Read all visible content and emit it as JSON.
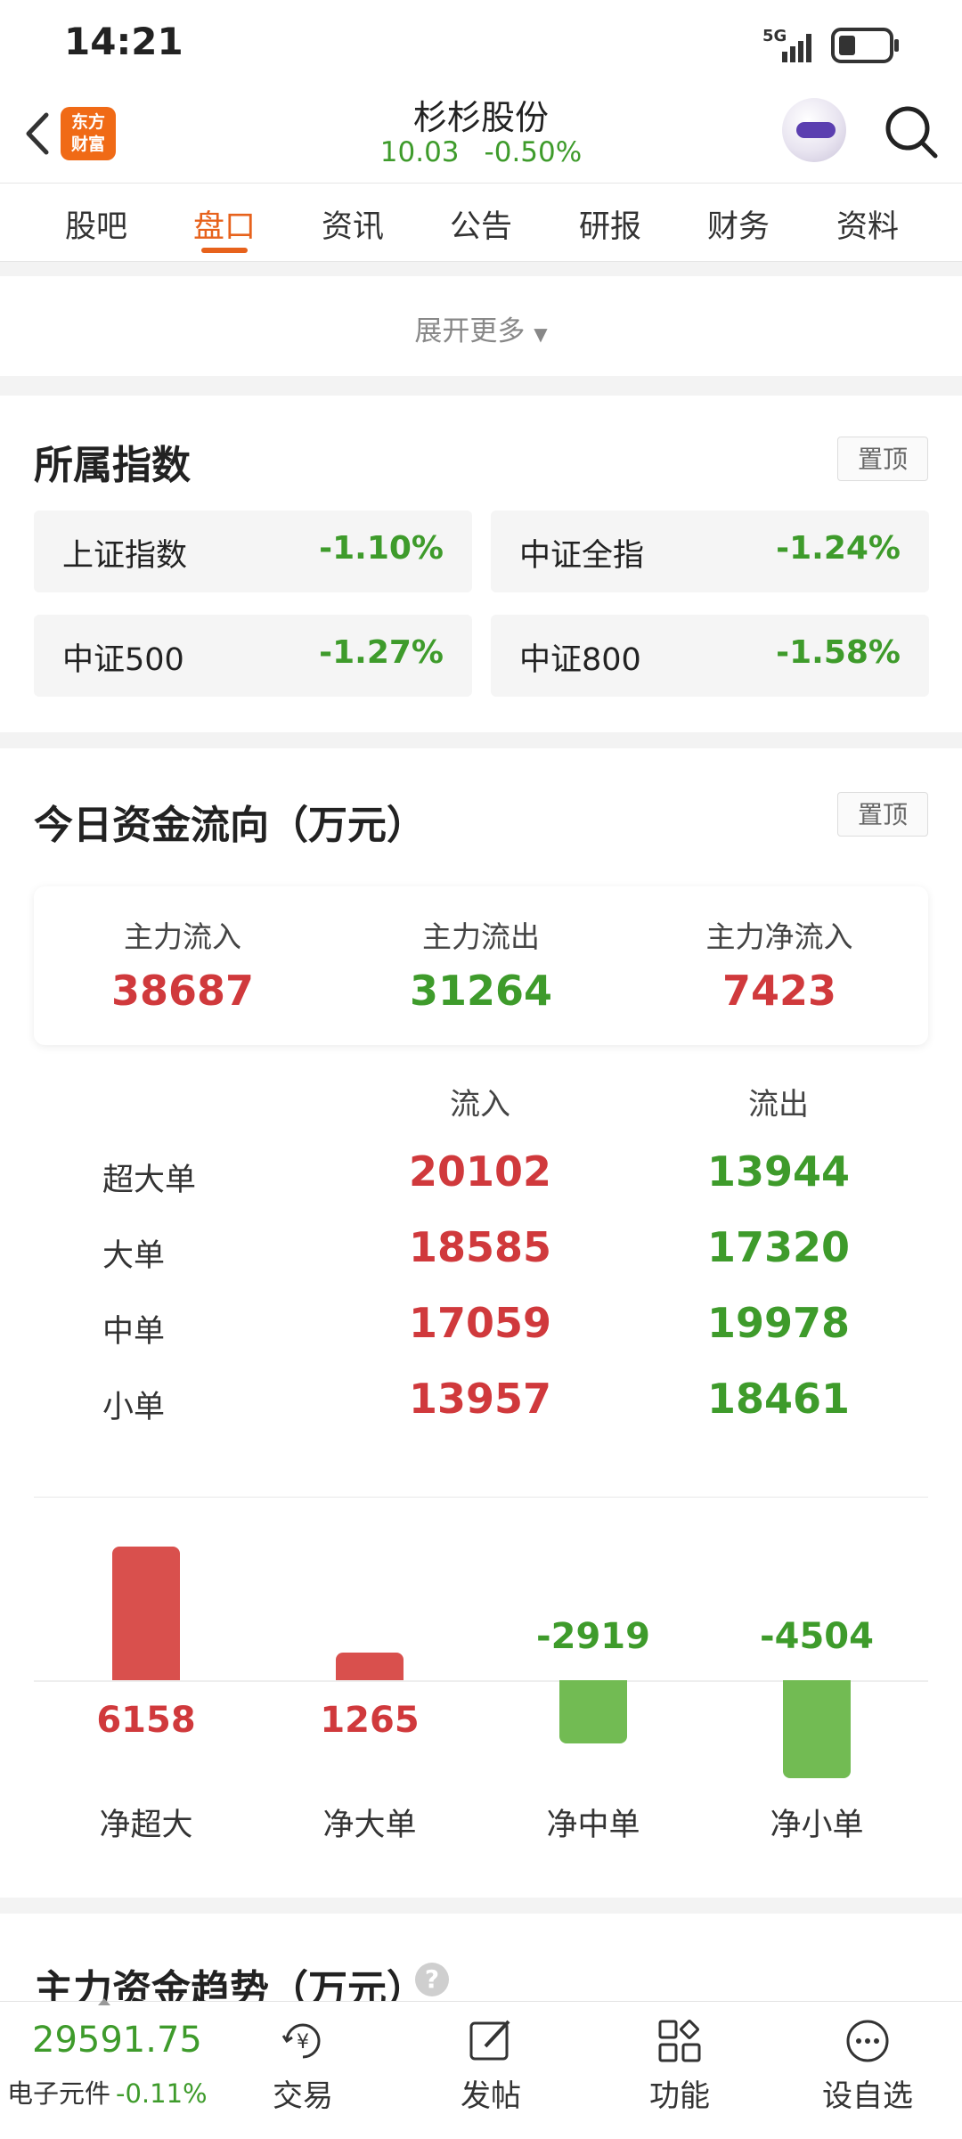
{
  "status_bar": {
    "time": "14:21",
    "network": "5G"
  },
  "header": {
    "logo_text_line1": "东方",
    "logo_text_line2": "财富",
    "title": "杉杉股份",
    "price": "10.03",
    "change": "-0.50%"
  },
  "tabs": [
    {
      "label": "股吧",
      "active": false
    },
    {
      "label": "盘口",
      "active": true
    },
    {
      "label": "资讯",
      "active": false
    },
    {
      "label": "公告",
      "active": false
    },
    {
      "label": "研报",
      "active": false
    },
    {
      "label": "财务",
      "active": false
    },
    {
      "label": "资料",
      "active": false
    }
  ],
  "expand_more": "展开更多",
  "indices": {
    "title": "所属指数",
    "pin_label": "置顶",
    "items": [
      {
        "name": "上证指数",
        "value": "-1.10%"
      },
      {
        "name": "中证全指",
        "value": "-1.24%"
      },
      {
        "name": "中证500",
        "value": "-1.27%"
      },
      {
        "name": "中证800",
        "value": "-1.58%"
      }
    ]
  },
  "fund_flow": {
    "title": "今日资金流向（万元）",
    "pin_label": "置顶",
    "summary": [
      {
        "label": "主力流入",
        "value": "38687"
      },
      {
        "label": "主力流出",
        "value": "31264"
      },
      {
        "label": "主力净流入",
        "value": "7423"
      }
    ],
    "col_in": "流入",
    "col_out": "流出",
    "rows": [
      {
        "label": "超大单",
        "in": "20102",
        "out": "13944"
      },
      {
        "label": "大单",
        "in": "18585",
        "out": "17320"
      },
      {
        "label": "中单",
        "in": "17059",
        "out": "19978"
      },
      {
        "label": "小单",
        "in": "13957",
        "out": "18461"
      }
    ],
    "net": [
      {
        "label": "净超大",
        "value": 6158,
        "text": "6158"
      },
      {
        "label": "净大单",
        "value": 1265,
        "text": "1265"
      },
      {
        "label": "净中单",
        "value": -2919,
        "text": "-2919"
      },
      {
        "label": "净小单",
        "value": -4504,
        "text": "-4504"
      }
    ]
  },
  "trend": {
    "title": "主力资金趋势（万元）",
    "help_icon": "?"
  },
  "bottom_nav": {
    "index_value": "29591.75",
    "index_name": "电子元件",
    "index_change": "-0.11%",
    "items": [
      {
        "label": "交易",
        "icon": "yuan-cycle-icon"
      },
      {
        "label": "发帖",
        "icon": "edit-icon"
      },
      {
        "label": "功能",
        "icon": "grid-icon"
      },
      {
        "label": "设自选",
        "icon": "more-icon"
      }
    ]
  },
  "colors": {
    "accent": "#e7621c",
    "up": "#d0393c",
    "down": "#3e9b2b"
  }
}
